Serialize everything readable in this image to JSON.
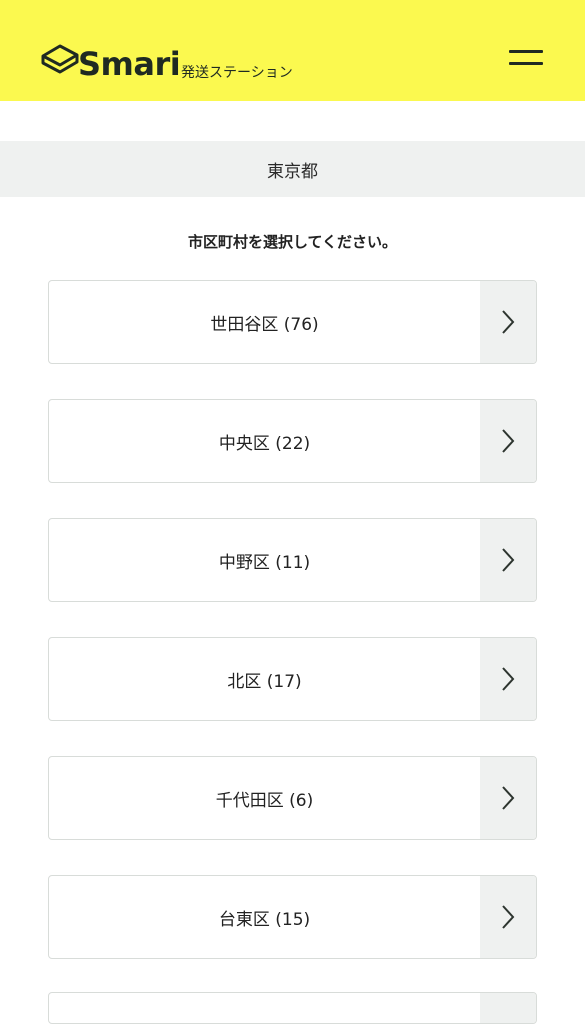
{
  "header": {
    "logo_text": "Smari",
    "logo_sub": "発送ステーション",
    "menu_icon": "hamburger-icon",
    "background_color": "#fbf94f"
  },
  "prefecture": {
    "name": "東京都"
  },
  "instruction": "市区町村を選択してください。",
  "districts": [
    {
      "label": "世田谷区 (76)"
    },
    {
      "label": "中央区 (22)"
    },
    {
      "label": "中野区 (11)"
    },
    {
      "label": "北区 (17)"
    },
    {
      "label": "千代田区 (6)"
    },
    {
      "label": "台東区 (15)"
    },
    {
      "label": ""
    }
  ],
  "item_arrow_icon": "chevron-right-icon"
}
